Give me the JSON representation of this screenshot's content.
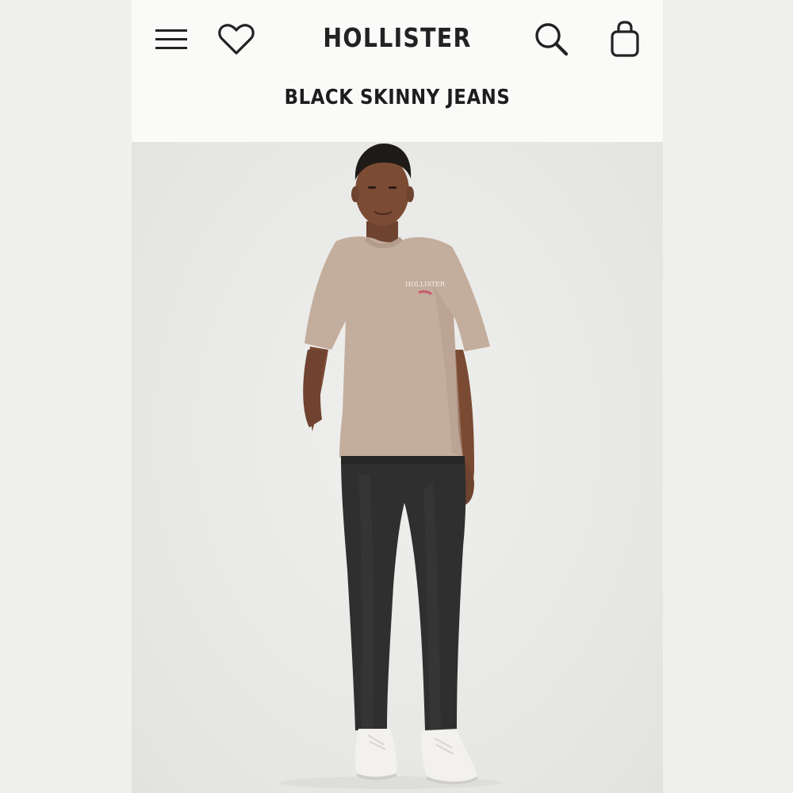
{
  "header": {
    "brand": "HOLLISTER",
    "menu_icon": "menu-icon",
    "wishlist_icon": "heart-icon",
    "search_icon": "search-icon",
    "bag_icon": "shopping-bag-icon"
  },
  "product": {
    "title": "BLACK SKINNY JEANS"
  },
  "colors": {
    "header_bg": "#fafaf9",
    "text": "#1d1d1d",
    "photo_bg": "#e9e9e7"
  }
}
